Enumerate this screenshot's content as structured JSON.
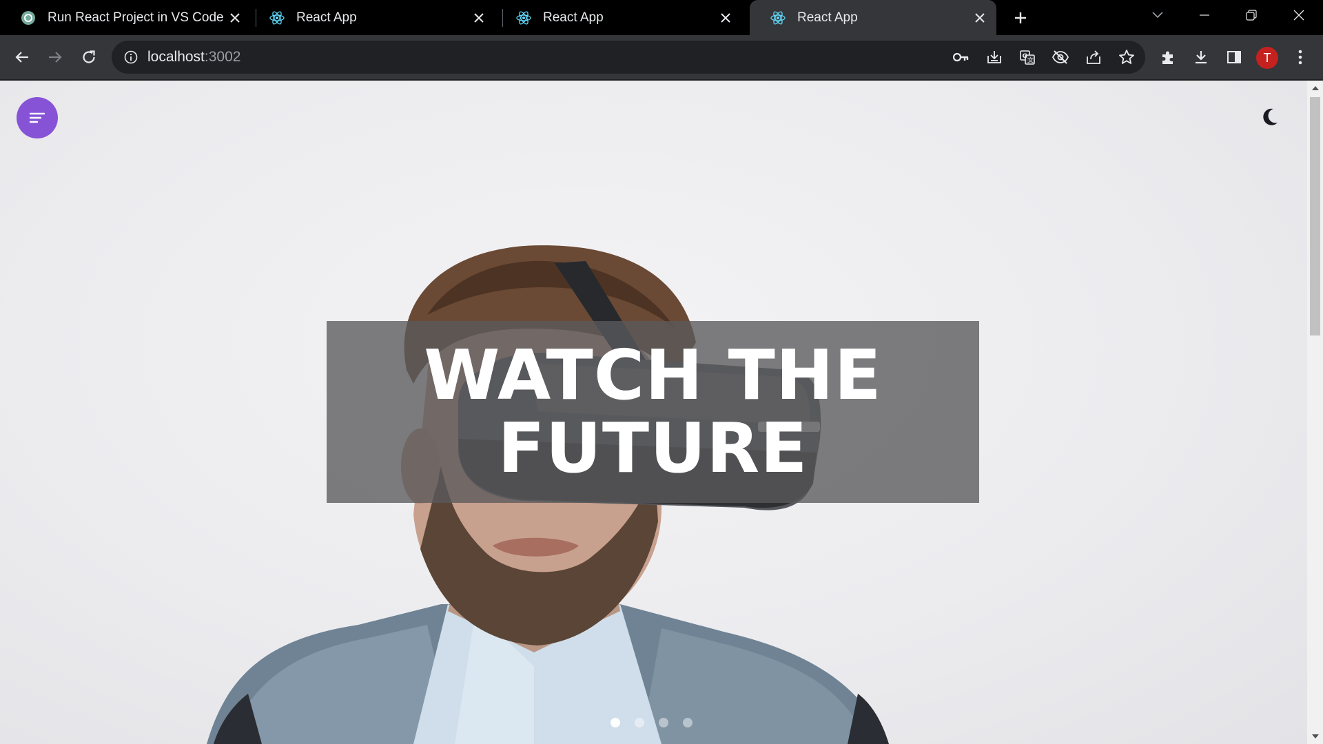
{
  "browser": {
    "tabs": [
      {
        "title": "Run React Project in VS Code",
        "favicon": "chatgpt-icon",
        "active": false
      },
      {
        "title": "React App",
        "favicon": "react-icon",
        "active": false
      },
      {
        "title": "React App",
        "favicon": "react-icon",
        "active": false
      },
      {
        "title": "React App",
        "favicon": "react-icon",
        "active": true
      }
    ],
    "address": {
      "host": "localhost",
      "port": ":3002"
    },
    "profile_initial": "T",
    "colors": {
      "tabstrip": "#000000",
      "toolbar": "#35363a",
      "omnibox": "#202124",
      "profile": "#c5221f"
    }
  },
  "page": {
    "headline_line1": "WATCH THE",
    "headline_line2": "FUTURE",
    "menu_icon": "menu-lines-icon",
    "theme_icon": "moon-icon",
    "carousel": {
      "count": 4,
      "active": 1
    },
    "colors": {
      "menu_button": "#8753d6",
      "overlay": "#5a5a5c",
      "headline": "#ffffff"
    }
  }
}
